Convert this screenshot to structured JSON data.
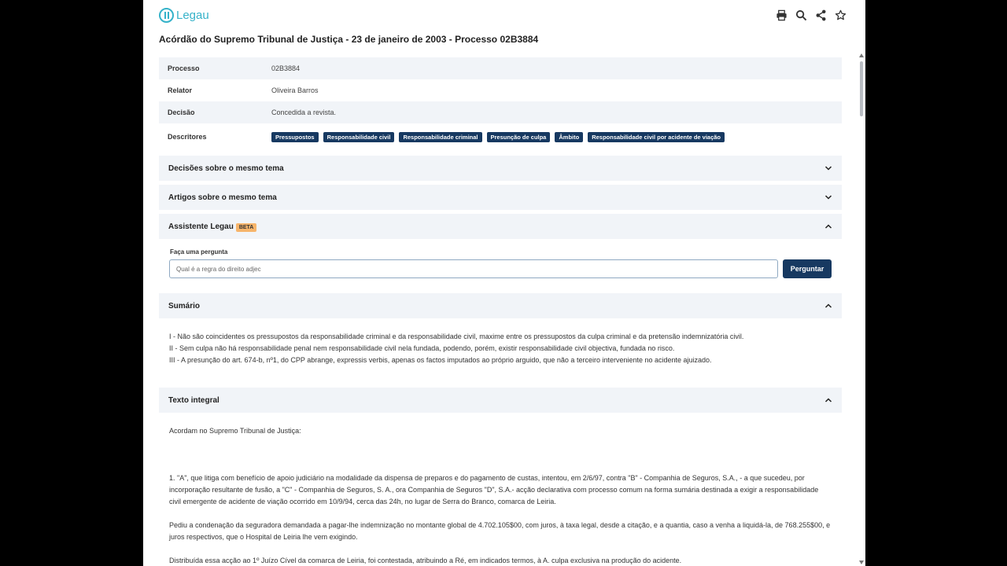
{
  "app": {
    "logo_text": "Legau"
  },
  "toolbar": {
    "icons": [
      "print-icon",
      "search-icon",
      "share-icon",
      "star-icon"
    ]
  },
  "page": {
    "title": "Acórdão do Supremo Tribunal de Justiça - 23 de janeiro de 2003 - Processo 02B3884"
  },
  "meta": {
    "rows": [
      {
        "label": "Processo",
        "value": "02B3884"
      },
      {
        "label": "Relator",
        "value": "Oliveira Barros"
      },
      {
        "label": "Decisão",
        "value": "Concedida a revista."
      }
    ],
    "descritores_label": "Descritores",
    "descritores": [
      "Pressupostos",
      "Responsabilidade civil",
      "Responsabilidade criminal",
      "Presunção de culpa",
      "Âmbito",
      "Responsabilidade civil por acidente de viação"
    ]
  },
  "sections": {
    "decisoes": "Decisões sobre o mesmo tema",
    "artigos": "Artigos sobre o mesmo tema",
    "assistente": "Assistente Legau",
    "beta": "BETA",
    "sumario": "Sumário",
    "texto": "Texto integral"
  },
  "ask": {
    "label": "Faça uma pergunta",
    "value": "Qual é a regra do direito adjec",
    "button": "Perguntar"
  },
  "summary": [
    "I - Não são coincidentes os pressupostos da responsabilidade criminal e da responsabilidade civil, maxime entre os pressupostos da culpa criminal e da pretensão indemnizatória civil.",
    "II - Sem culpa não há responsabilidade penal nem responsabilidade civil nela fundada, podendo, porém, existir responsabilidade civil objectiva, fundada no risco.",
    "III - A presunção do art. 674-b, nº1, do CPP abrange, expressis verbis, apenas os factos imputados ao próprio arguido, que não a terceiro interveniente no acidente ajuizado."
  ],
  "full_text": [
    "Acordam no Supremo Tribunal de Justiça:",
    "1. \"A\", que litiga com benefício de apoio judiciário na modalidade da dispensa de preparos e do pagamento de custas, intentou, em 2/6/97, contra \"B\" - Companhia de Seguros, S.A., - a que sucedeu, por incorporação resultante de fusão, a \"C\" - Companhia de Seguros, S. A., ora Companhia de Seguros \"D\", S.A.- acção declarativa com processo comum na forma sumária destinada a exigir a responsabilidade civil emergente de acidente de viação ocorrido em 10/9/94, cerca das 24h, no lugar de Serra do Branco, comarca de Leiria.",
    "Pediu a condenação da seguradora demandada a pagar-lhe indemnização no montante global de 4.702.105$00, com juros, à taxa legal, desde a citação, e a quantia, caso a venha a liquidá-la, de 768.255$00, e juros respectivos, que o Hospital de Leiria lhe vem exigindo.",
    "Distribuída essa acção ao 1º Juízo Cível da comarca de Leiria, foi contestada, atribuindo a Ré, em indicados termos, à A. culpa exclusiva na produção do acidente."
  ]
}
